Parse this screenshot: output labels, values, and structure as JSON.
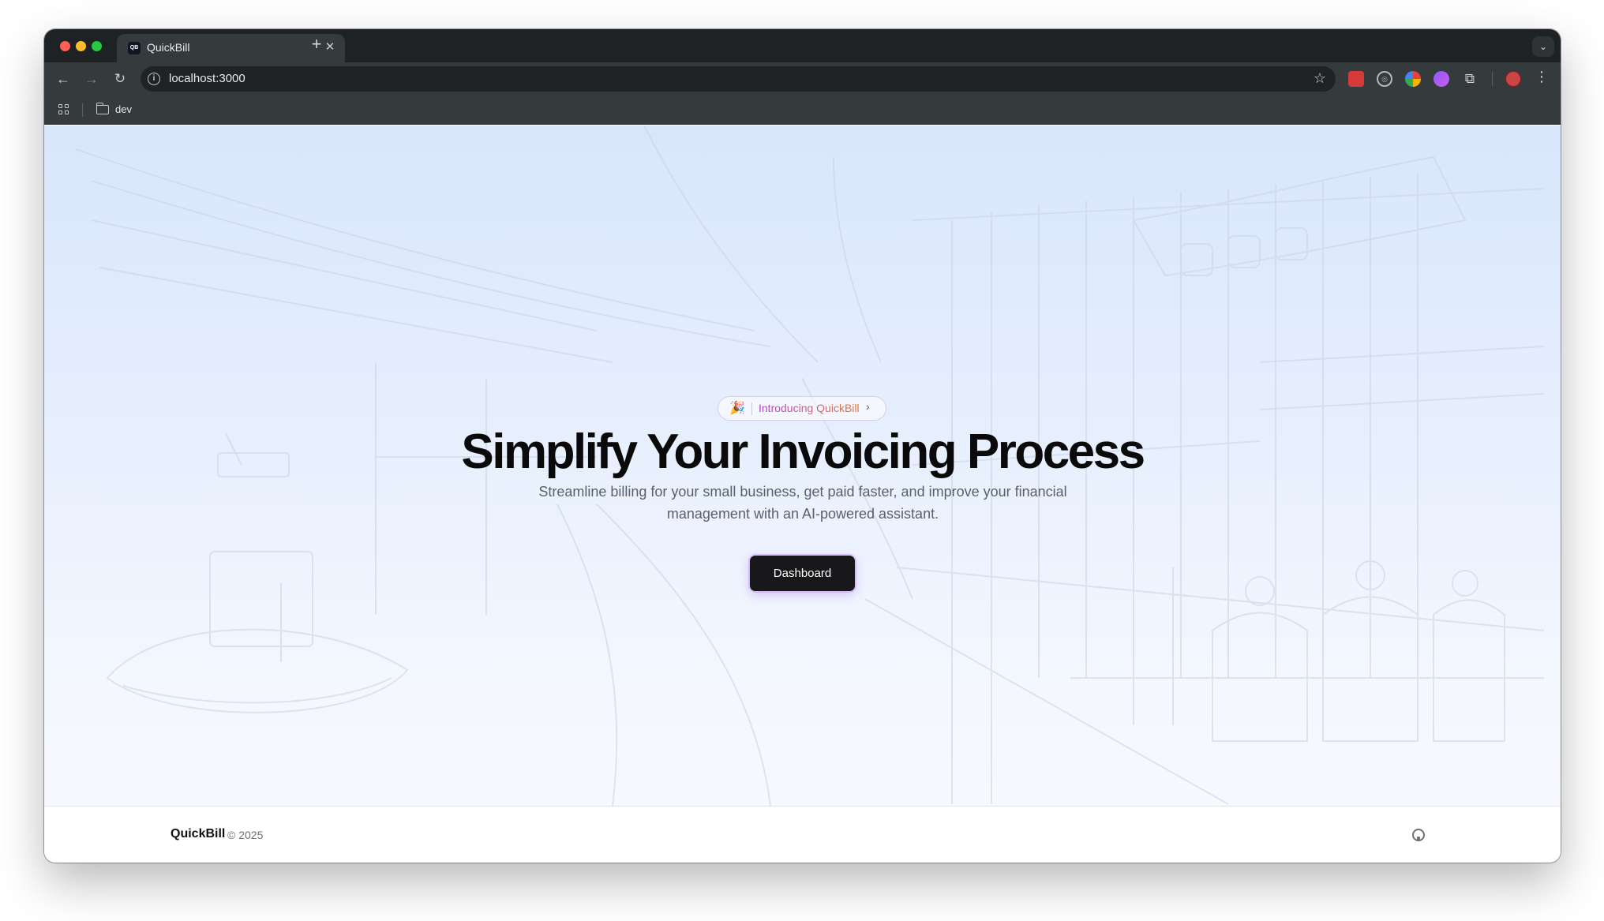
{
  "browser": {
    "tab": {
      "favicon_text": "QB",
      "title": "QuickBill",
      "close_glyph": "✕"
    },
    "new_tab_glyph": "+",
    "tab_search_glyph": "⌄",
    "url": "localhost:3000",
    "bookmarks": [
      {
        "label": "dev",
        "icon": "folder-icon"
      }
    ],
    "icons": [
      "back-icon",
      "forward-icon",
      "reload-icon",
      "site-info-icon",
      "bookmark-star-icon",
      "extensions-icon",
      "profile-avatar",
      "menu-icon",
      "apps-icon"
    ]
  },
  "hero": {
    "badge": {
      "emoji": "🎉",
      "text": "Introducing QuickBill",
      "chevron": "›"
    },
    "title": "Simplify Your Invoicing Process",
    "subtitle": "Streamline billing for your small business, get paid faster, and improve your financial management with an AI-powered assistant.",
    "cta_label": "Dashboard"
  },
  "footer": {
    "brand": "QuickBill",
    "copyright": "© 2025",
    "icon": "github-icon"
  },
  "colors": {
    "hero_bg_top": "#d8e6fc",
    "hero_bg_bottom": "#f7f9fe",
    "cta_bg": "#18181b",
    "badge_gradient_start": "#b044c8",
    "badge_gradient_end": "#e07a3a"
  }
}
